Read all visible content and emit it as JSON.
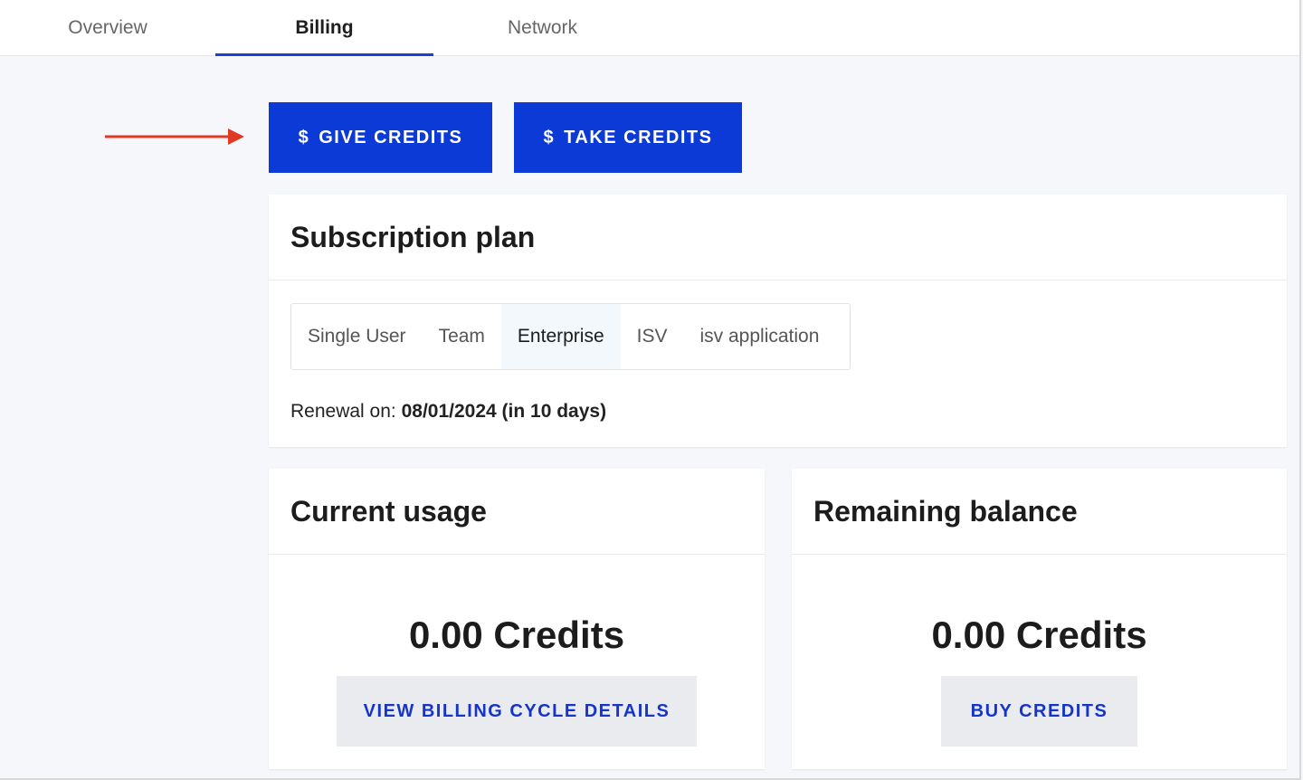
{
  "tabs": [
    {
      "label": "Overview"
    },
    {
      "label": "Billing"
    },
    {
      "label": "Network"
    }
  ],
  "actions": {
    "give_label": "GIVE CREDITS",
    "take_label": "TAKE CREDITS",
    "currency_symbol": "$"
  },
  "subscription": {
    "title": "Subscription plan",
    "plans": [
      "Single User",
      "Team",
      "Enterprise",
      "ISV",
      "isv application"
    ],
    "selected": "Enterprise",
    "renewal_label": "Renewal on:",
    "renewal_value": "08/01/2024 (in 10 days)"
  },
  "usage": {
    "title": "Current usage",
    "amount": "0.00 Credits",
    "button_label": "VIEW BILLING CYCLE DETAILS"
  },
  "balance": {
    "title": "Remaining balance",
    "amount": "0.00 Credits",
    "button_label": "BUY CREDITS"
  },
  "colors": {
    "accent": "#0b3ad6",
    "arrow": "#e03a22",
    "link": "#1534c9"
  },
  "icons": {
    "annotation_arrow": "arrow-right-icon",
    "dollar": "dollar-icon"
  }
}
